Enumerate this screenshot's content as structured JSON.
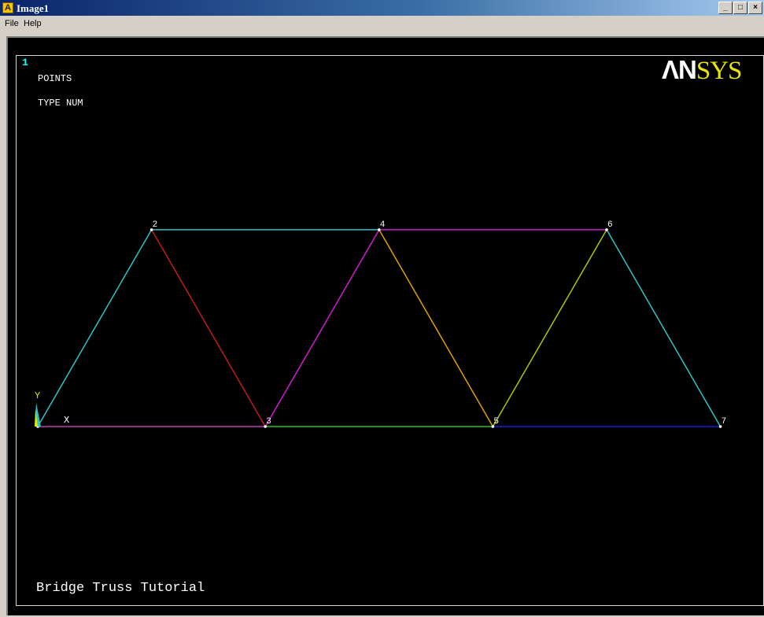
{
  "window": {
    "title": "Image1",
    "app_icon_letter": "A",
    "controls": [
      "_",
      "□",
      "×"
    ]
  },
  "menu": [
    "File",
    "Help"
  ],
  "graphics": {
    "window_number": "1",
    "labels": [
      "POINTS",
      "TYPE NUM"
    ],
    "logo_part1": "ΛN",
    "logo_part2": "SYS",
    "footer": "Bridge Truss Tutorial",
    "triad": {
      "y_label": "Y",
      "x_label": "X"
    }
  },
  "keypoints": [
    {
      "label": "2",
      "coord": [
        2,
        3.464
      ]
    },
    {
      "label": "4",
      "coord": [
        6,
        3.464
      ]
    },
    {
      "label": "6",
      "coord": [
        10,
        3.464
      ]
    },
    {
      "label": "3",
      "coord": [
        4,
        0
      ]
    },
    {
      "label": "5",
      "coord": [
        8,
        0
      ]
    },
    {
      "label": "7",
      "coord": [
        12,
        0
      ]
    }
  ],
  "lines": [
    {
      "from": [
        0,
        0
      ],
      "to": [
        2,
        3.464
      ],
      "color": "#2ec4c4"
    },
    {
      "from": [
        2,
        3.464
      ],
      "to": [
        6,
        3.464
      ],
      "color": "#2ec4c4"
    },
    {
      "from": [
        2,
        3.464
      ],
      "to": [
        4,
        0
      ],
      "color": "#c21a1a"
    },
    {
      "from": [
        4,
        0
      ],
      "to": [
        6,
        3.464
      ],
      "color": "#d01ad0"
    },
    {
      "from": [
        6,
        3.464
      ],
      "to": [
        10,
        3.464
      ],
      "color": "#d01ad0"
    },
    {
      "from": [
        6,
        3.464
      ],
      "to": [
        8,
        0
      ],
      "color": "#e0a000"
    },
    {
      "from": [
        8,
        0
      ],
      "to": [
        10,
        3.464
      ],
      "color": "#a8c800"
    },
    {
      "from": [
        10,
        3.464
      ],
      "to": [
        12,
        0
      ],
      "color": "#2ec4c4"
    },
    {
      "from": [
        0,
        0
      ],
      "to": [
        4,
        0
      ],
      "color": "#b83ab8"
    },
    {
      "from": [
        4,
        0
      ],
      "to": [
        8,
        0
      ],
      "color": "#1ac81a"
    },
    {
      "from": [
        8,
        0
      ],
      "to": [
        12,
        0
      ],
      "color": "#1a1ad0"
    }
  ]
}
